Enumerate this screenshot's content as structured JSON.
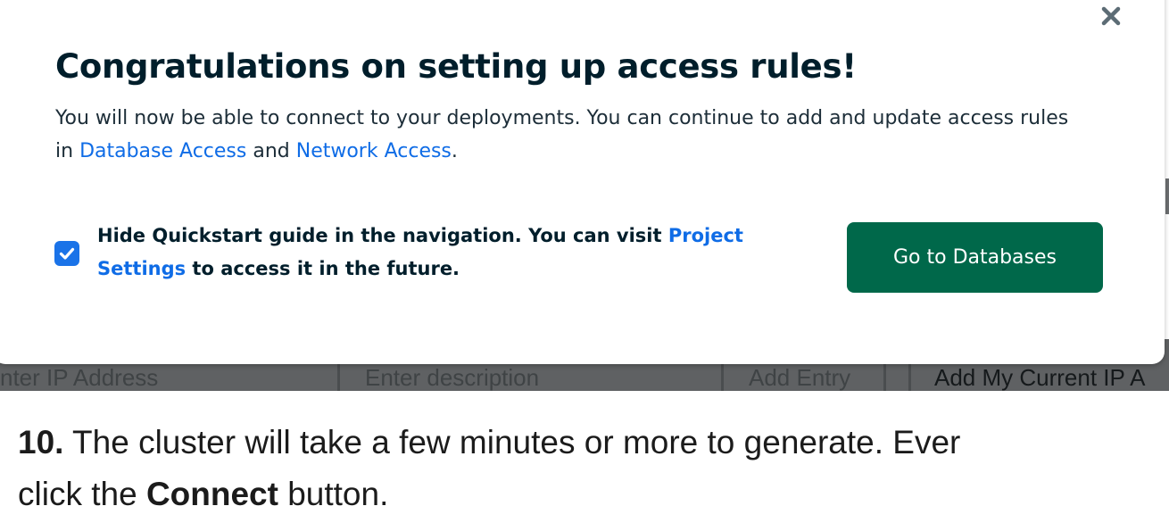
{
  "background_form": {
    "ip_placeholder": "nter IP Address",
    "description_placeholder": "Enter description",
    "add_entry_label": "Add Entry",
    "add_current_ip_label": "Add My Current IP A"
  },
  "modal": {
    "title": "Congratulations on setting up access rules!",
    "description_prefix": "You will now be able to connect to your deployments. You can continue to add and update access rules in ",
    "database_access_link": "Database Access",
    "description_middle": " and ",
    "network_access_link": "Network Access",
    "description_suffix": ".",
    "checkbox_checked": true,
    "checkbox_label_prefix": "Hide Quickstart guide in the navigation. You can visit ",
    "project_settings_link": "Project Settings",
    "checkbox_label_suffix": " to access it in the future.",
    "primary_button_label": "Go to Databases",
    "close_icon": "close-icon"
  },
  "article": {
    "step_number": "10.",
    "line1_text": " The cluster will take a few minutes or more to generate. Ever",
    "line2_prefix": "click the ",
    "connect_bold": "Connect",
    "line2_suffix": " button."
  },
  "colors": {
    "primary_button": "#00684a",
    "link": "#0f6ce6",
    "checkbox": "#1a73e8",
    "title": "#001e2b"
  }
}
